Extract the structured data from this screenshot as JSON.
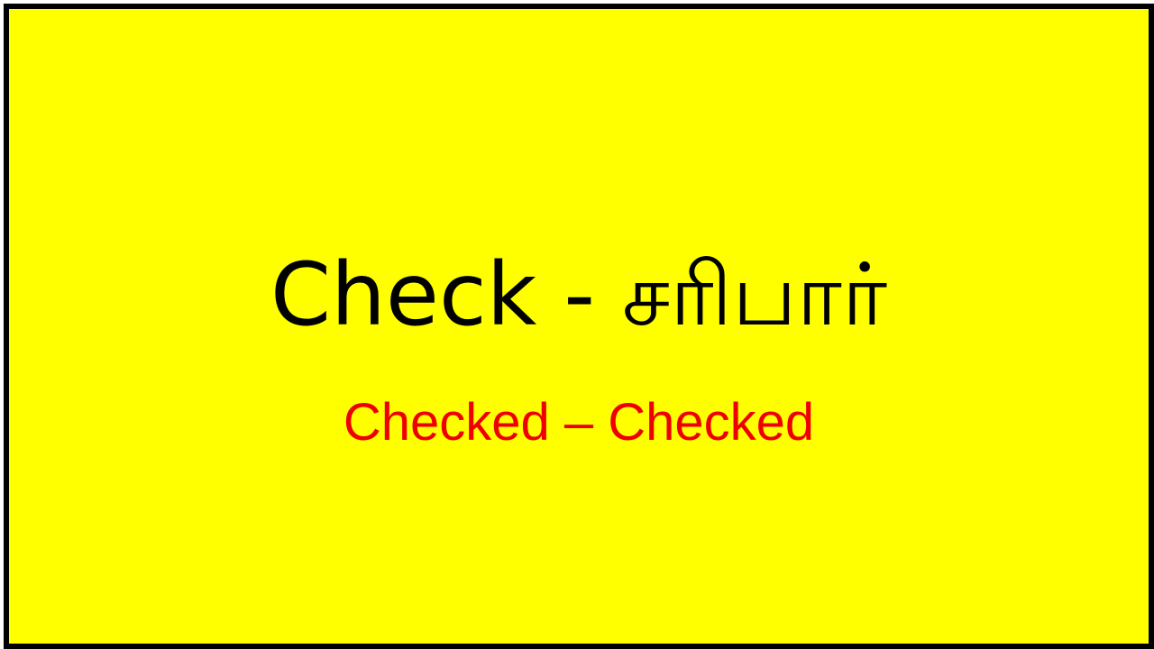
{
  "slide": {
    "title_english": "Check",
    "title_separator": "-",
    "title_tamil": "சரிபார்",
    "subtitle": "Checked – Checked"
  },
  "colors": {
    "background": "#ffff00",
    "border": "#000000",
    "title": "#000000",
    "subtitle": "#ee0000"
  }
}
